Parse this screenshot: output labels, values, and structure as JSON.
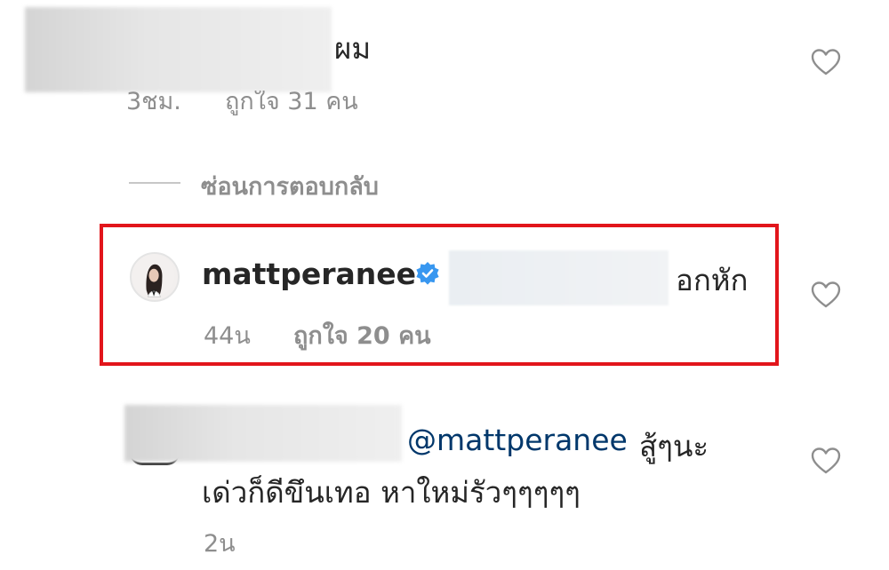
{
  "comment1": {
    "text_visible": "ผม",
    "time": "3ชม.",
    "likes": "ถูกใจ 31 คน"
  },
  "replies_toggle": {
    "label": "ซ่อนการตอบกลับ"
  },
  "comment2": {
    "username": "mattperanee",
    "verified": true,
    "text": "อกหัก",
    "time": "44น",
    "likes": "ถูกใจ 20 คน",
    "highlight_color": "#e2151b"
  },
  "comment3": {
    "mention": "@mattperanee",
    "text_line1": "สู้ๆนะ",
    "text_line2": "เด่วก็ดีขึนเทอ หาใหม่รัวๆๆๆๆๆ",
    "time": "2น"
  },
  "icons": {
    "like": "heart-outline-icon",
    "verified": "verified-badge-icon"
  },
  "colors": {
    "text": "#262626",
    "meta": "#8e8e8e",
    "mention": "#00376b",
    "verified": "#3897f0"
  }
}
